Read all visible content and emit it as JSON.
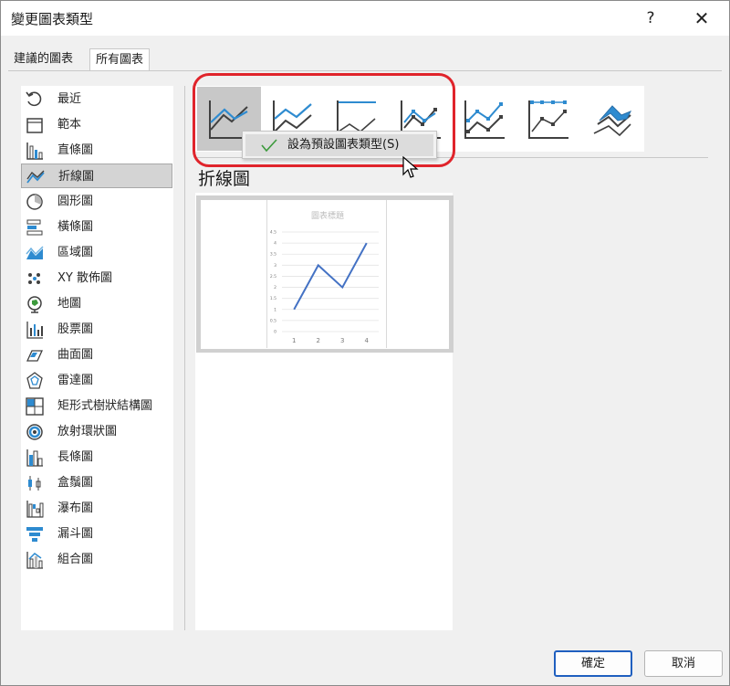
{
  "window": {
    "title": "變更圖表類型",
    "help_glyph": "?",
    "close_glyph": "✕"
  },
  "tabs": [
    {
      "label": "建議的圖表"
    },
    {
      "label": "所有圖表",
      "active": true
    }
  ],
  "categories": [
    {
      "label": "最近",
      "icon": "recent-icon"
    },
    {
      "label": "範本",
      "icon": "template-icon"
    },
    {
      "label": "直條圖",
      "icon": "column-chart-icon"
    },
    {
      "label": "折線圖",
      "icon": "line-chart-icon",
      "selected": true
    },
    {
      "label": "圓形圖",
      "icon": "pie-chart-icon"
    },
    {
      "label": "橫條圖",
      "icon": "bar-chart-icon"
    },
    {
      "label": "區域圖",
      "icon": "area-chart-icon"
    },
    {
      "label": "XY 散佈圖",
      "icon": "scatter-chart-icon"
    },
    {
      "label": "地圖",
      "icon": "map-chart-icon"
    },
    {
      "label": "股票圖",
      "icon": "stock-chart-icon"
    },
    {
      "label": "曲面圖",
      "icon": "surface-chart-icon"
    },
    {
      "label": "雷達圖",
      "icon": "radar-chart-icon"
    },
    {
      "label": "矩形式樹狀結構圖",
      "icon": "treemap-chart-icon"
    },
    {
      "label": "放射環狀圖",
      "icon": "sunburst-chart-icon"
    },
    {
      "label": "長條圖",
      "icon": "histogram-chart-icon"
    },
    {
      "label": "盒鬚圖",
      "icon": "box-whisker-chart-icon"
    },
    {
      "label": "瀑布圖",
      "icon": "waterfall-chart-icon"
    },
    {
      "label": "漏斗圖",
      "icon": "funnel-chart-icon"
    },
    {
      "label": "組合圖",
      "icon": "combo-chart-icon"
    }
  ],
  "subtypes": [
    {
      "name": "line",
      "selected": true
    },
    {
      "name": "stacked-line"
    },
    {
      "name": "100-stacked-line"
    },
    {
      "name": "line-with-markers"
    },
    {
      "name": "stacked-line-with-markers"
    },
    {
      "name": "100-stacked-line-with-markers"
    },
    {
      "name": "3d-line"
    }
  ],
  "section_heading": "折線圖",
  "context_menu": {
    "item_label": "設為預設圖表類型(S)",
    "icon": "check-icon"
  },
  "buttons": {
    "ok": "確定",
    "cancel": "取消"
  },
  "colors": {
    "accent_blue": "#2e8bd0",
    "line_blue": "#4472c4",
    "highlight_red": "#e0242b"
  },
  "chart_data": {
    "type": "line",
    "title": "圖表標題",
    "categories": [
      "1",
      "2",
      "3",
      "4"
    ],
    "series": [
      {
        "values": [
          1,
          3,
          2,
          4
        ]
      }
    ],
    "y_ticks": [
      "4.5",
      "4",
      "3.5",
      "3",
      "2.5",
      "2",
      "1.5",
      "1",
      "0.5",
      "0"
    ],
    "ylim": [
      0,
      4.5
    ],
    "grid": true
  }
}
